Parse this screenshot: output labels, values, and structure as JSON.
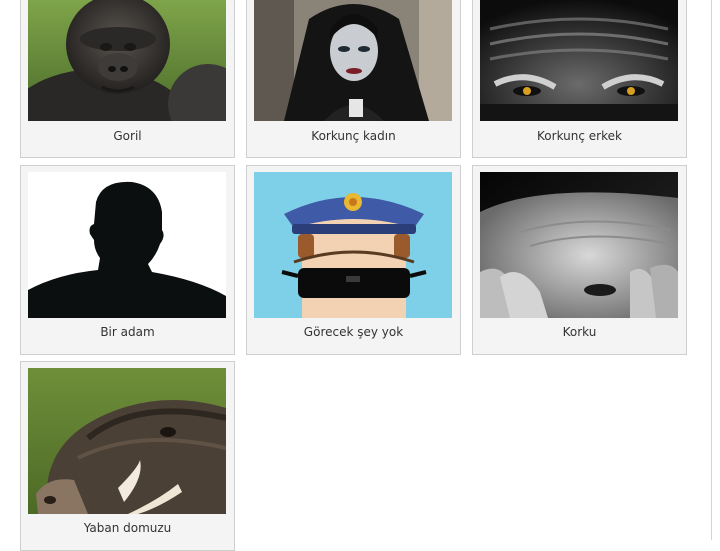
{
  "gallery": {
    "items": [
      {
        "label": "Goril",
        "image": "gorilla"
      },
      {
        "label": "Korkunç kadın",
        "image": "scary-woman"
      },
      {
        "label": "Korkunç erkek",
        "image": "scary-man-eyes"
      },
      {
        "label": "Bir adam",
        "image": "man-silhouette"
      },
      {
        "label": "Görecek şey yok",
        "image": "cartoon-police-officer"
      },
      {
        "label": "Korku",
        "image": "frightened-face"
      },
      {
        "label": "Yaban domuzu",
        "image": "wild-boar"
      }
    ]
  },
  "colors": {
    "card_bg": "#f4f4f4",
    "card_border": "#cfcfcf",
    "caption_text": "#333333"
  }
}
